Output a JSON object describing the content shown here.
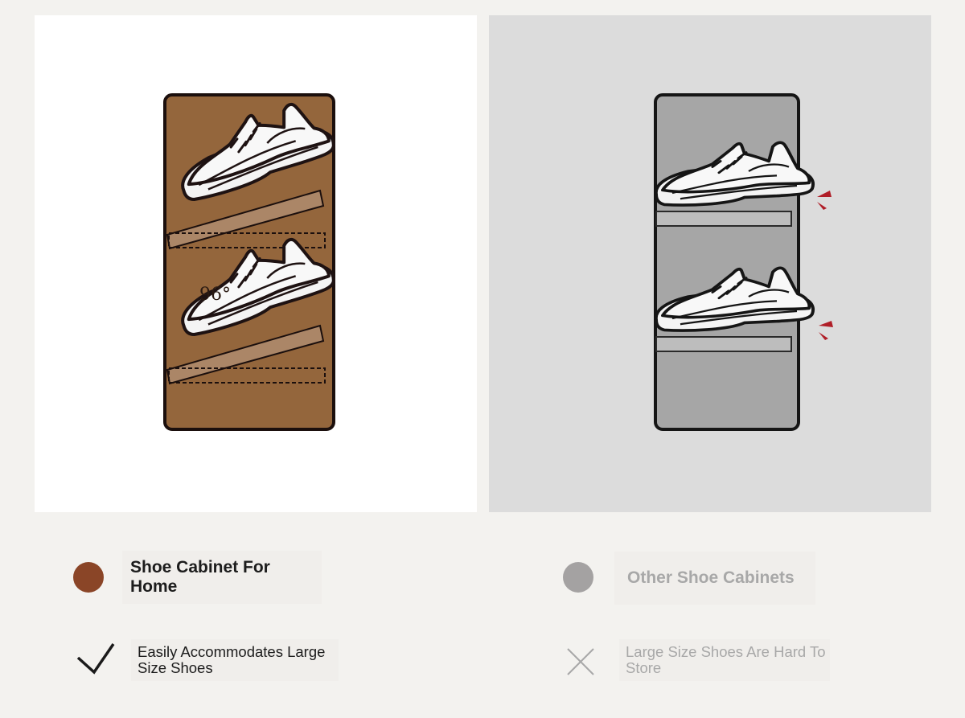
{
  "left": {
    "title": "Shoe Cabinet For Home",
    "description": "Easily Accommodates Large Size Shoes",
    "shelf_label": "96°",
    "dot_color": "#8a4527",
    "cabinet_color": "#94663c",
    "shelf_color": "#ab8667",
    "text_color": "#1c1c1c"
  },
  "right": {
    "title": "Other Shoe Cabinets",
    "description": "Large Size Shoes Are Hard To Store",
    "dot_color": "#a4a2a2",
    "cabinet_color": "#a6a6a6",
    "shelf_color": "#bdbdbd",
    "text_color": "#a8a8a8",
    "alert_color": "#b01e28"
  },
  "icons": {
    "check": "check-icon",
    "cross": "cross-icon",
    "shoe": "sneaker-icon"
  }
}
